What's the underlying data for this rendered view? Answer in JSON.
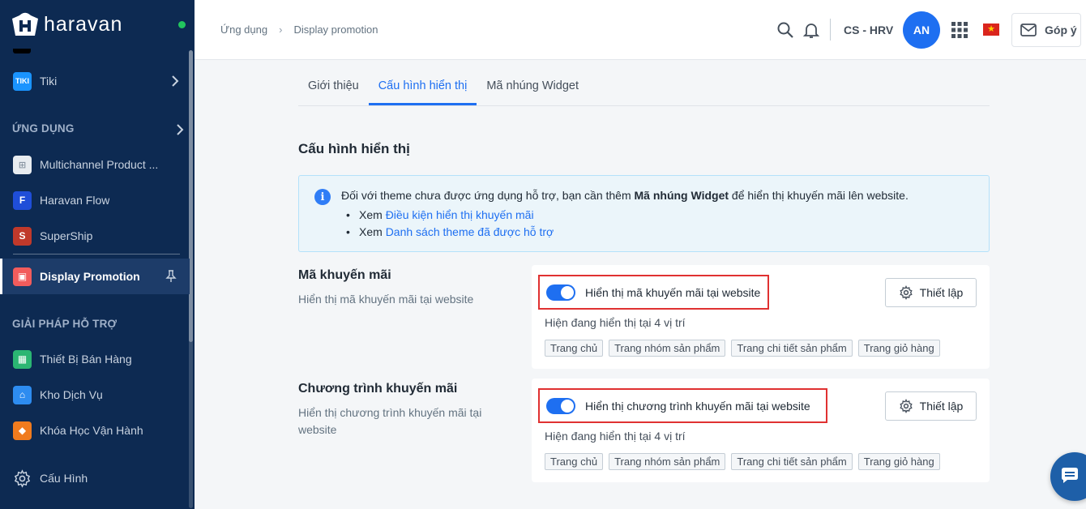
{
  "brand": {
    "name": "haravan"
  },
  "sidebar": {
    "items_top": [
      {
        "label": "Tiki",
        "icon": "tiki-icon",
        "color": "#1a94ff"
      }
    ],
    "section_apps": "ỨNG DỤNG",
    "apps": [
      {
        "label": "Multichannel Product ...",
        "icon": "multichannel-icon",
        "color": "#e8ecf0"
      },
      {
        "label": "Haravan Flow",
        "icon": "flow-icon",
        "color": "#1f4ed8"
      },
      {
        "label": "SuperShip",
        "icon": "supership-icon",
        "color": "#c0392b"
      },
      {
        "label": "Display Promotion",
        "icon": "display-promotion-icon",
        "color": "#f25c5c"
      }
    ],
    "section_support": "GIẢI PHÁP HỖ TRỢ",
    "support": [
      {
        "label": "Thiết Bị Bán Hàng",
        "icon": "pos-device-icon",
        "color": "#2bb673"
      },
      {
        "label": "Kho Dịch Vụ",
        "icon": "service-store-icon",
        "color": "#2d8cf0"
      },
      {
        "label": "Khóa Học Vận Hành",
        "icon": "course-icon",
        "color": "#f07b1e"
      }
    ],
    "settings": "Cấu Hình"
  },
  "topbar": {
    "breadcrumb": [
      "Ứng dụng",
      "Display promotion"
    ],
    "shop_name": "CS - HRV",
    "avatar_initials": "AN",
    "feedback_label": "Góp ý"
  },
  "tabs": [
    {
      "label": "Giới thiệu",
      "active": false
    },
    {
      "label": "Cấu hình hiển thị",
      "active": true
    },
    {
      "label": "Mã nhúng Widget",
      "active": false
    }
  ],
  "page_title": "Cấu hình hiển thị",
  "info": {
    "text_before": "Đối với theme chưa được ứng dụng hỗ trợ, bạn cần thêm ",
    "text_bold": "Mã nhúng Widget",
    "text_after": " để hiển thị khuyến mãi lên website.",
    "prefix": "Xem ",
    "links": [
      "Điều kiện hiển thị khuyến mãi",
      "Danh sách theme đã được hỗ trợ"
    ]
  },
  "sections": [
    {
      "title": "Mã khuyến mãi",
      "desc": "Hiển thị mã khuyến mãi tại website",
      "toggle_label": "Hiển thị mã khuyến mãi tại website",
      "toggle_on": true,
      "setup_label": "Thiết lập",
      "positions_text": "Hiện đang hiển thị tại 4 vị trí",
      "positions": [
        "Trang chủ",
        "Trang nhóm sản phẩm",
        "Trang chi tiết sản phẩm",
        "Trang giỏ hàng"
      ]
    },
    {
      "title": "Chương trình khuyến mãi",
      "desc": "Hiển thị chương trình khuyến mãi tại website",
      "toggle_label": "Hiển thị chương trình khuyến mãi tại website",
      "toggle_on": true,
      "setup_label": "Thiết lập",
      "positions_text": "Hiện đang hiển thị tại 4 vị trí",
      "positions": [
        "Trang chủ",
        "Trang nhóm sản phẩm",
        "Trang chi tiết sản phẩm",
        "Trang giỏ hàng"
      ]
    }
  ],
  "colors": {
    "sidebar": "#0d2a52",
    "accent": "#1e6ff1",
    "highlight": "#e03131"
  }
}
